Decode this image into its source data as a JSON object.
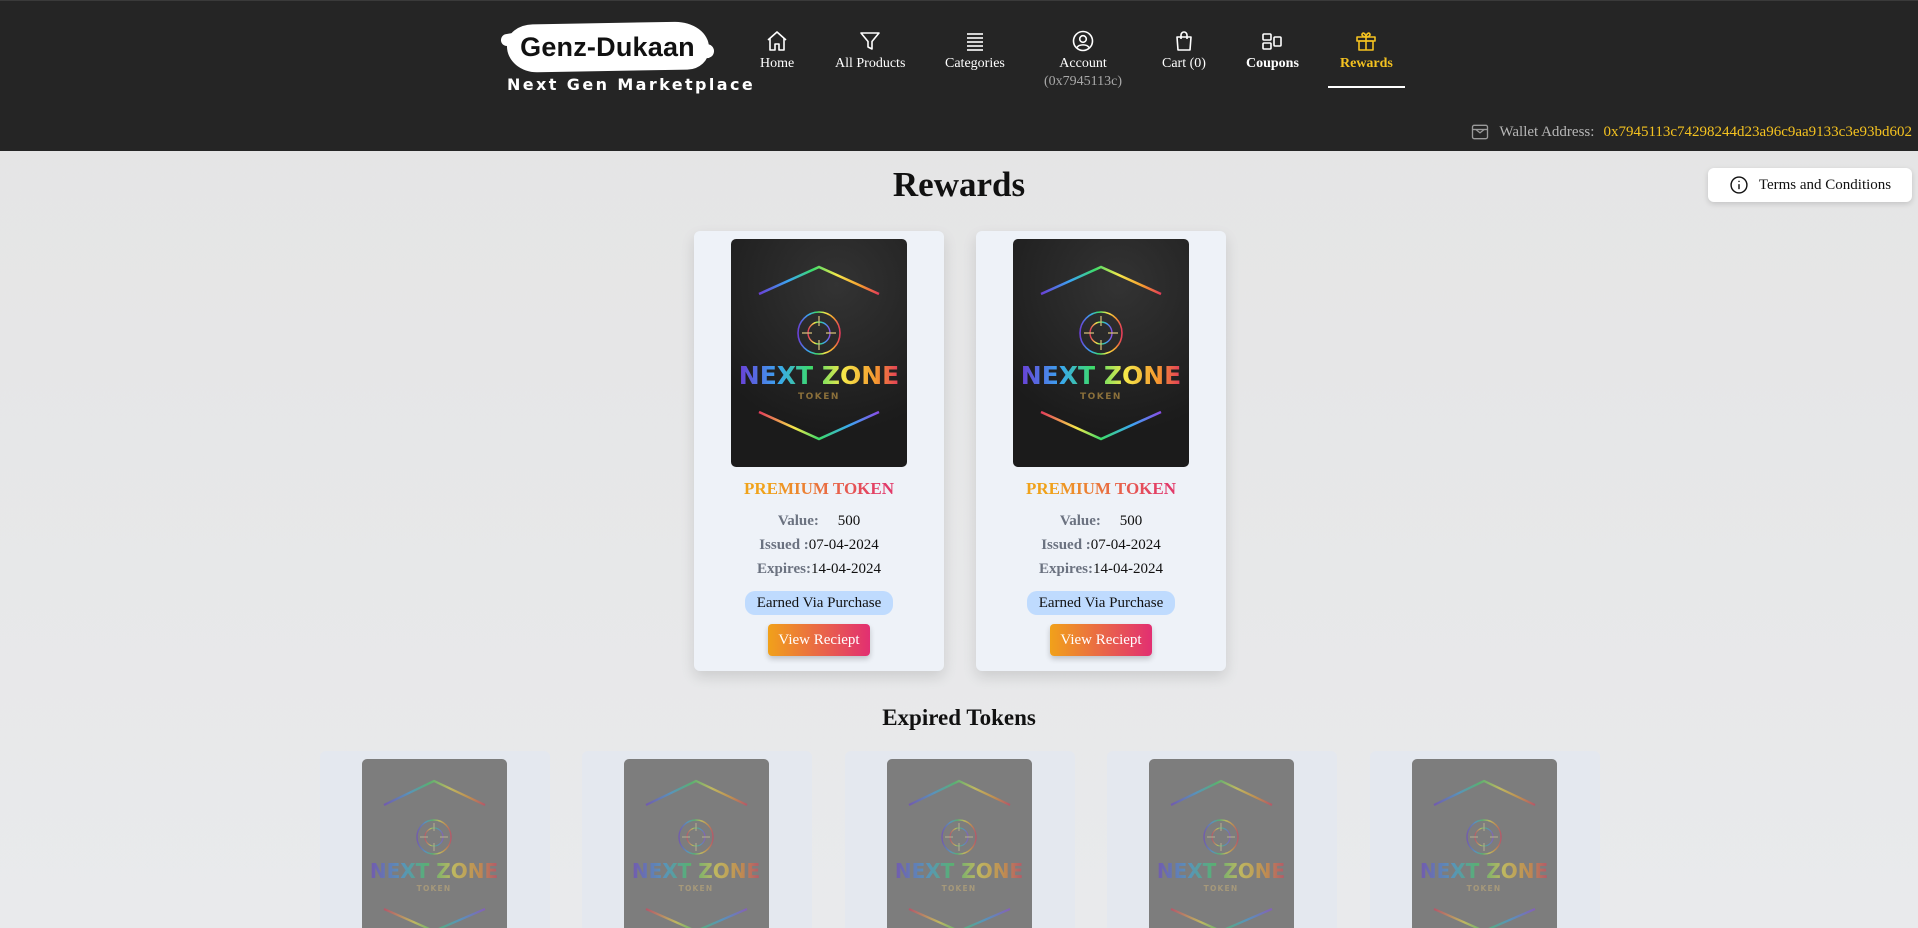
{
  "brand": {
    "name": "Genz-Dukaan",
    "tagline": "Next Gen Marketplace"
  },
  "nav": {
    "home": "Home",
    "all_products": "All Products",
    "categories": "Categories",
    "account": "Account",
    "account_id": "(0x7945113c)",
    "cart": "Cart (0)",
    "coupons": "Coupons",
    "rewards": "Rewards",
    "active": "rewards"
  },
  "wallet": {
    "label": "Wallet Address:",
    "address": "0x7945113c74298244d23a96c9aa9133c3e93bd602"
  },
  "colors": {
    "header_bg": "#252525",
    "accent_yellow": "#f4c220",
    "gradient_start": "#f1a11a",
    "gradient_end": "#e22f72",
    "badge_bg": "#bfdbfe"
  },
  "page": {
    "title": "Rewards",
    "terms_label": "Terms and Conditions",
    "expired_title": "Expired Tokens"
  },
  "token_art": {
    "wordmark": "NEXT ZONE",
    "sub": "TOKEN"
  },
  "rewards": [
    {
      "name": "PREMIUM TOKEN",
      "value_label": "Value:",
      "value": "500",
      "issued_label": "Issued :",
      "issued": "07-04-2024",
      "expires_label": "Expires:",
      "expires": "14-04-2024",
      "badge": "Earned Via Purchase",
      "button": "View Reciept"
    },
    {
      "name": "PREMIUM TOKEN",
      "value_label": "Value:",
      "value": "500",
      "issued_label": "Issued :",
      "issued": "07-04-2024",
      "expires_label": "Expires:",
      "expires": "14-04-2024",
      "badge": "Earned Via Purchase",
      "button": "View Reciept"
    }
  ],
  "expired_count": 5
}
